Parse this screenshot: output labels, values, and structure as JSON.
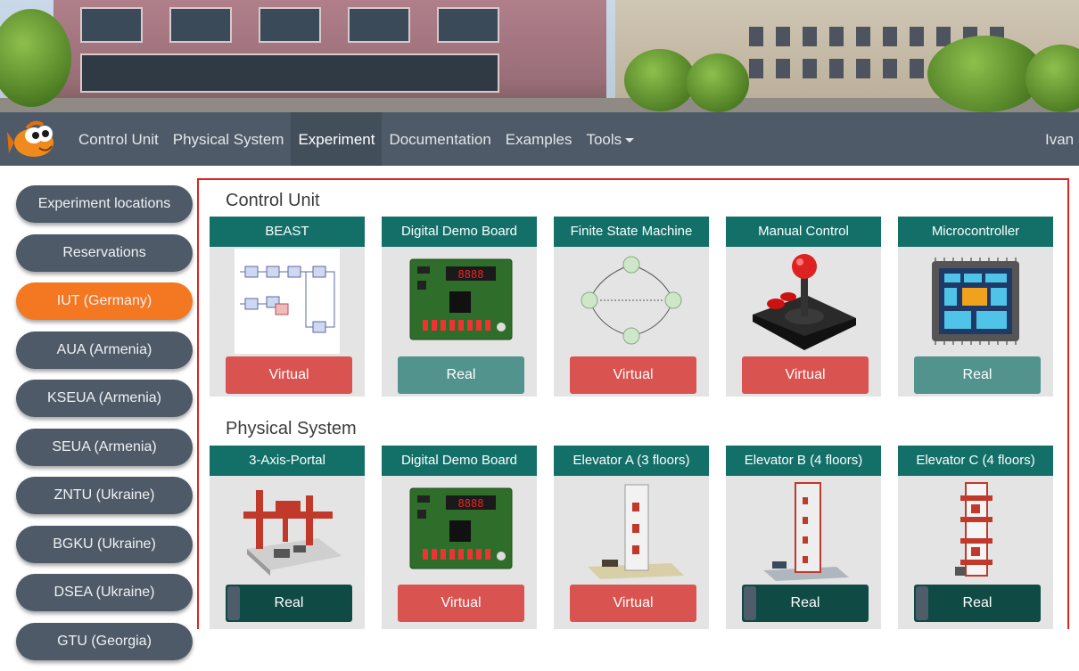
{
  "navbar": {
    "items": [
      {
        "label": "Control Unit"
      },
      {
        "label": "Physical System"
      },
      {
        "label": "Experiment",
        "active": true
      },
      {
        "label": "Documentation"
      },
      {
        "label": "Examples"
      },
      {
        "label": "Tools"
      }
    ],
    "user": "Ivan S"
  },
  "sidebar": {
    "items": [
      {
        "label": "Experiment locations"
      },
      {
        "label": "Reservations"
      },
      {
        "label": "IUT (Germany)",
        "active": true
      },
      {
        "label": "AUA (Armenia)"
      },
      {
        "label": "KSEUA (Armenia)"
      },
      {
        "label": "SEUA (Armenia)"
      },
      {
        "label": "ZNTU (Ukraine)"
      },
      {
        "label": "BGKU (Ukraine)"
      },
      {
        "label": "DSEA (Ukraine)"
      },
      {
        "label": "GTU (Georgia)"
      }
    ]
  },
  "sections": [
    {
      "title": "Control Unit",
      "cards": [
        {
          "title": "BEAST",
          "mode": "Virtual",
          "image": "block-diagram-image"
        },
        {
          "title": "Digital Demo Board",
          "mode": "Real",
          "image": "circuit-board-image"
        },
        {
          "title": "Finite State Machine",
          "mode": "Virtual",
          "image": "state-diagram-image"
        },
        {
          "title": "Manual Control",
          "mode": "Virtual",
          "image": "joystick-image"
        },
        {
          "title": "Microcontroller",
          "mode": "Real",
          "image": "microchip-image"
        }
      ]
    },
    {
      "title": "Physical System",
      "cards": [
        {
          "title": "3-Axis-Portal",
          "mode": "Real",
          "image": "portal-robot-image"
        },
        {
          "title": "Digital Demo Board",
          "mode": "Virtual",
          "image": "circuit-board-image"
        },
        {
          "title": "Elevator A (3 floors)",
          "mode": "Virtual",
          "image": "elevator-model-image"
        },
        {
          "title": "Elevator B (4 floors)",
          "mode": "Real",
          "image": "elevator-model-image"
        },
        {
          "title": "Elevator C (4 floors)",
          "mode": "Real",
          "image": "elevator-model-image"
        }
      ]
    }
  ],
  "colors": {
    "navbar": "#4e5a68",
    "active_location": "#f47721",
    "card_header": "#127068",
    "virtual_button": "#d95350",
    "real_button": "#52938e",
    "panel_border": "#e0231f"
  }
}
